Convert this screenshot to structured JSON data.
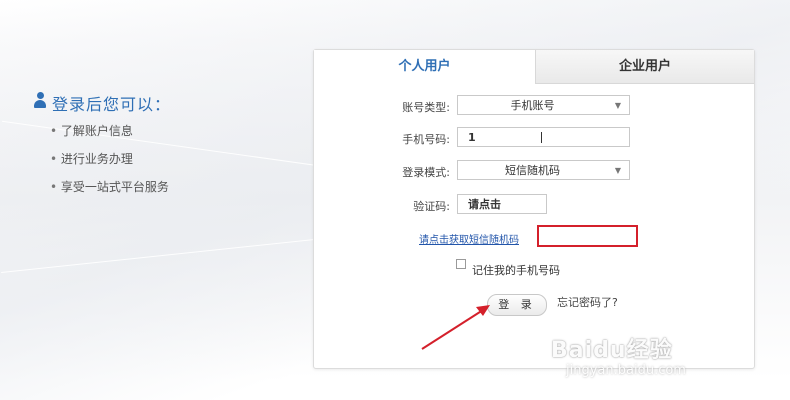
{
  "left": {
    "title": "登录后您可以：",
    "items": [
      "了解账户信息",
      "进行业务办理",
      "享受一站式平台服务"
    ]
  },
  "tabs": {
    "personal": "个人用户",
    "enterprise": "企业用户"
  },
  "form": {
    "account_type_label": "账号类型:",
    "account_type_value": "手机账号",
    "phone_label": "手机号码:",
    "phone_value": "1",
    "login_mode_label": "登录模式:",
    "login_mode_value": "短信随机码",
    "captcha_label": "验证码:",
    "captcha_value": "请点击",
    "get_sms_link": "请点击获取短信随机码",
    "remember_label": "记住我的手机号码",
    "login_button": "登 录",
    "forgot_password": "忘记密码了?"
  },
  "watermark": {
    "logo": "Baidu经验",
    "url": "jingyan.baidu.com"
  },
  "colors": {
    "accent": "#2f6fb5",
    "highlight": "#d4202b"
  }
}
